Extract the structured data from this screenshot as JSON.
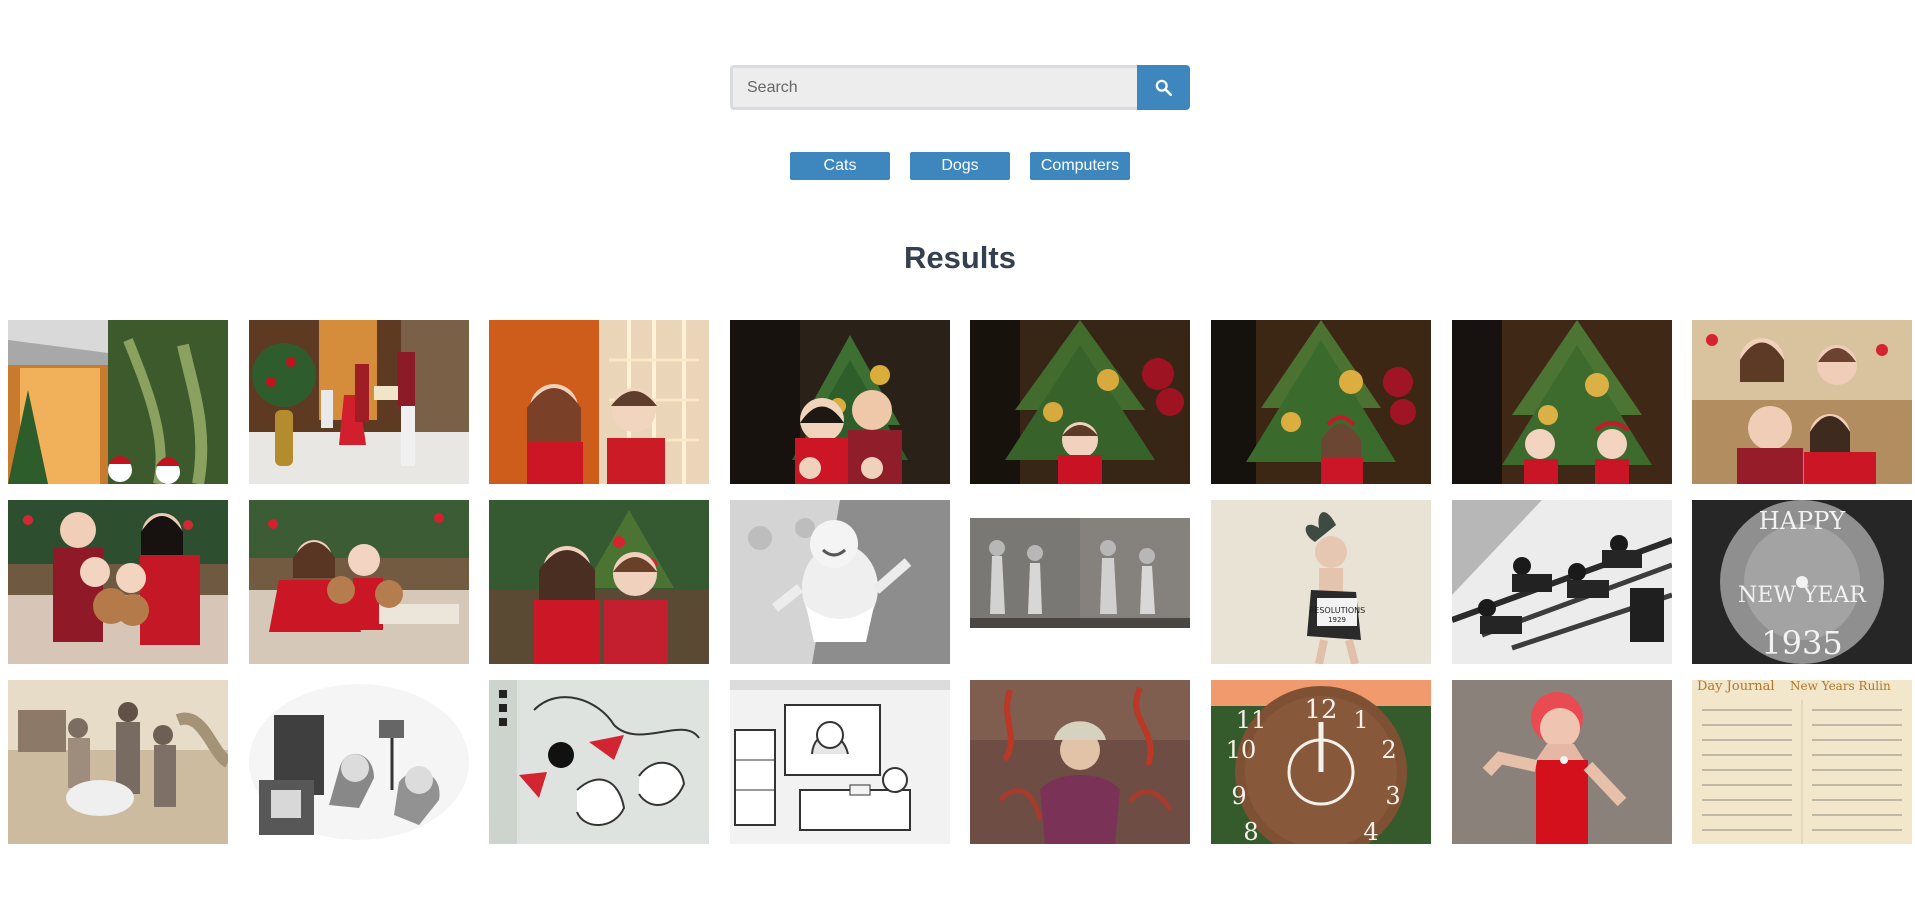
{
  "search": {
    "placeholder": "Search",
    "button_icon": "search-icon"
  },
  "quick_filters": [
    {
      "label": "Cats"
    },
    {
      "label": "Dogs"
    },
    {
      "label": "Computers"
    }
  ],
  "results": {
    "title": "Results"
  },
  "colors": {
    "accent": "#3d86be",
    "heading": "#34404d"
  }
}
